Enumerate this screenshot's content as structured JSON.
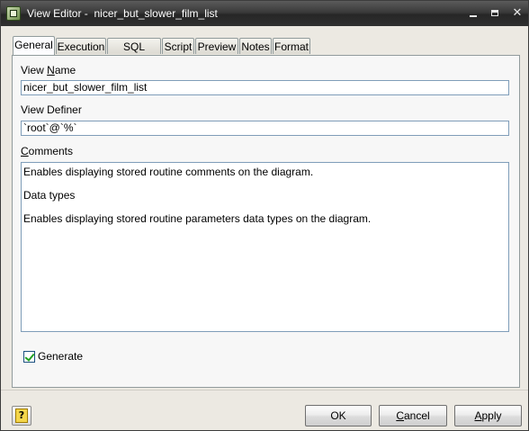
{
  "window": {
    "title": "View Editor -  nicer_but_slower_film_list",
    "minimize_icon": "minimize-icon",
    "maximize_icon": "maximize-icon",
    "close_icon": "close-icon",
    "close_glyph": "✕"
  },
  "tabs": [
    {
      "label": "General",
      "active": true
    },
    {
      "label": "Execution"
    },
    {
      "label": "SQL Query"
    },
    {
      "label": "Script"
    },
    {
      "label": "Preview"
    },
    {
      "label": "Notes"
    },
    {
      "label": "Format"
    }
  ],
  "general": {
    "view_name_label_pre": "View ",
    "view_name_label_ul": "N",
    "view_name_label_post": "ame",
    "view_name_value": "nicer_but_slower_film_list",
    "view_definer_label": "View Definer",
    "view_definer_value": "`root`@`%`",
    "comments_label_ul": "C",
    "comments_label_post": "omments",
    "comments_lines": [
      "Enables displaying stored routine comments on the diagram.",
      "Data types",
      "Enables displaying stored routine parameters data types on the diagram."
    ],
    "generate_label": "Generate",
    "generate_checked": true
  },
  "footer": {
    "help_glyph": "?",
    "ok_label": "OK",
    "cancel_ul": "C",
    "cancel_rest": "ancel",
    "apply_ul": "A",
    "apply_rest": "pply"
  }
}
